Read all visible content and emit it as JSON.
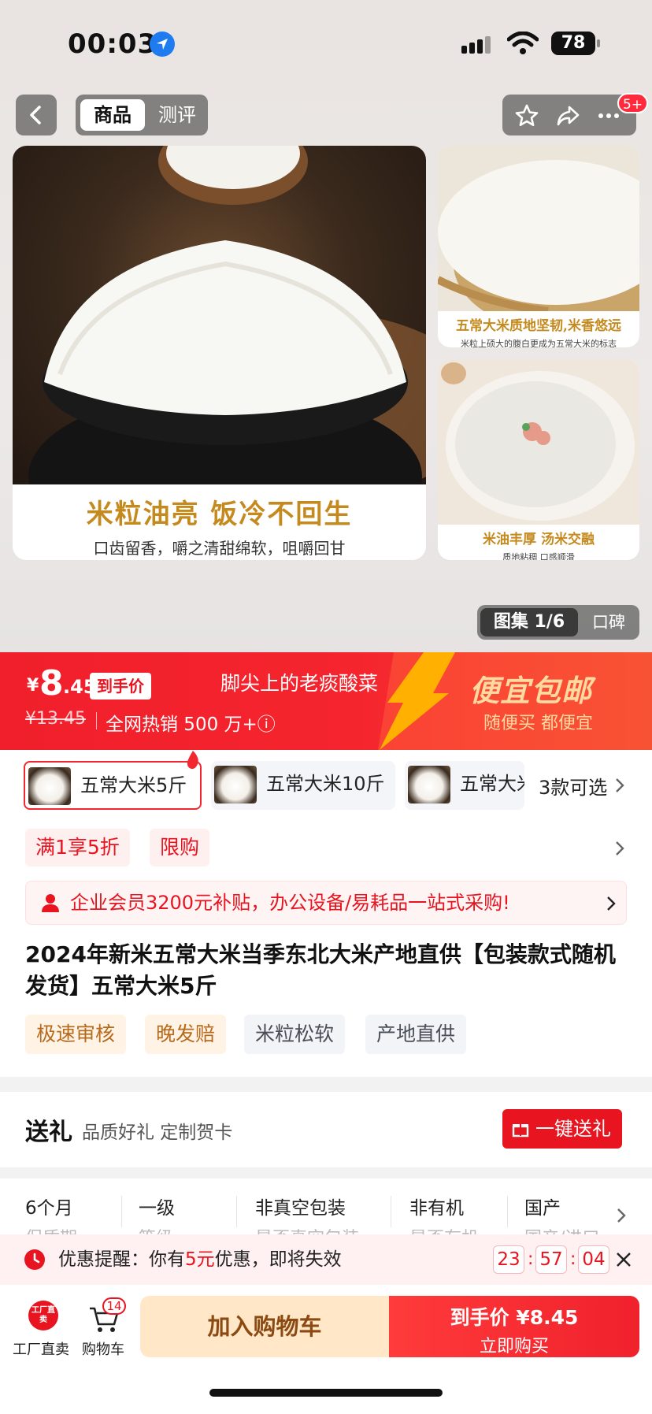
{
  "status_bar": {
    "time": "00:03",
    "battery": "78"
  },
  "nav": {
    "tab_active": "商品",
    "tab_inactive": "测评",
    "badge": "5+"
  },
  "gallery": {
    "main_caption_title": "米粒油亮 饭冷不回生",
    "main_caption_sub": "口齿留香，嚼之清甜绵软，咀嚼回甘",
    "side1_title": "五常大米质地坚韧,米香悠远",
    "side1_sub": "米粒上硕大的腹白更成为五常大米的标志",
    "side2_title": "米油丰厚 汤米交融",
    "side2_sub": "质地粘稠 口感顺滑",
    "album_active": "图集 1/6",
    "album_inactive": "口碑"
  },
  "price": {
    "yen": "¥",
    "main": "8",
    "decimal": ".45",
    "arrive_tag": "到手价",
    "original": "¥13.45",
    "hot_sale": "全网热销 500 万+ⓘ",
    "slogan": "脚尖上的老痰酸菜",
    "free_ship": "便宜包邮",
    "free_sub": "随便买 都便宜"
  },
  "skus": [
    {
      "label": "五常大米5斤"
    },
    {
      "label": "五常大米10斤"
    },
    {
      "label": "五常大米"
    }
  ],
  "sku_more": "3款可选",
  "promo_tags": [
    "满1享5折",
    "限购"
  ],
  "enterprise_text": "企业会员3200元补贴，办公设备/易耗品一站式采购!",
  "title": "2024年新米五常大米当季东北大米产地直供【包装款式随机发货】五常大米5斤",
  "tags": [
    "极速审核",
    "晚发赔",
    "米粒松软",
    "产地直供"
  ],
  "gift": {
    "title": "送礼",
    "sub": "品质好礼 定制贺卡",
    "button": "一键送礼"
  },
  "params": [
    {
      "value": "6个月",
      "label": "保质期"
    },
    {
      "value": "一级",
      "label": "等级"
    },
    {
      "value": "非真空包装",
      "label": "是否真空包装"
    },
    {
      "value": "非有机",
      "label": "是否有机"
    },
    {
      "value": "国产",
      "label": "国产/进口"
    }
  ],
  "reminder": {
    "prefix": "优惠提醒：你有",
    "amount": "5元",
    "suffix": "优惠，即将失效",
    "hh": "23",
    "mm": "57",
    "ss": "04"
  },
  "bottom": {
    "factory_icon_text": "工厂直卖",
    "factory_label": "工厂直卖",
    "cart_label": "购物车",
    "cart_count": "14",
    "add_cart": "加入购物车",
    "buy_top": "到手价 ¥8.45",
    "buy_sub": "立即购买"
  }
}
